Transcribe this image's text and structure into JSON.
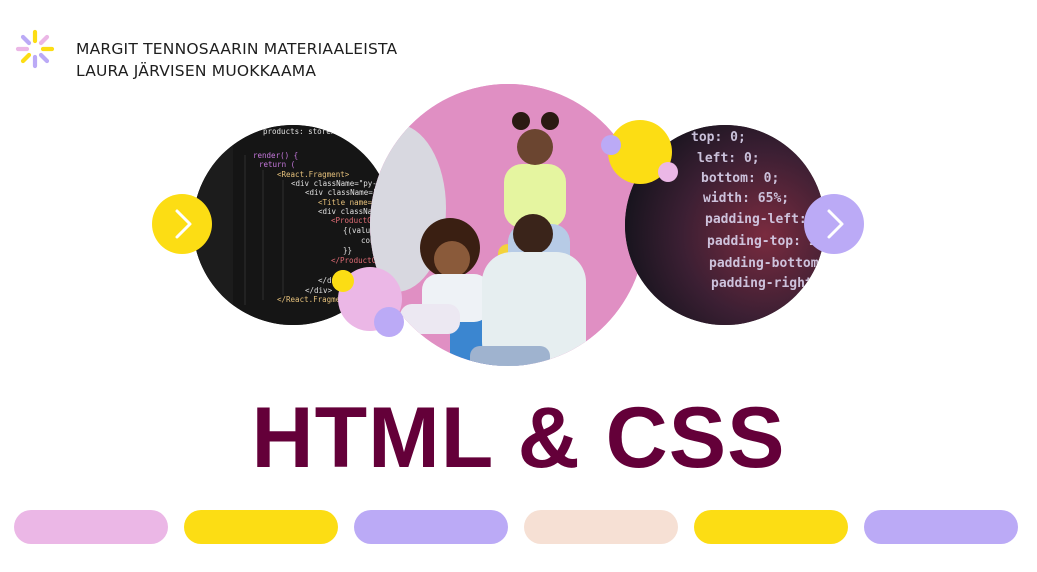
{
  "header": {
    "logo_icon": "asterisk-star-logo",
    "line1": "MARGIT TENNOSAARIN MATERIAALEISTA",
    "line2": "LAURA JÄRVISEN MUOKKAAMA"
  },
  "carousel": {
    "prev_icon": "chevron-right-icon",
    "next_icon": "chevron-right-icon",
    "left_code_lines": [
      "products: storeProd",
      "render() {",
      "return (",
      "<React.Fragment>",
      "<div className=\"py-5\">",
      "<div className=\"contain",
      "<Title name=\"our\" ti",
      "<div className=\"row\"",
      "<ProductConsumer",
      "{(value) =>",
      "console",
      "}}",
      "</ProductConsu",
      "</div>",
      "</div>",
      "</React.Fragment>"
    ],
    "right_code_lines": [
      "top: 0;",
      "left: 0;",
      "bottom: 0;",
      "width: 65%;",
      "padding-left: 1",
      "padding-top: 100",
      "padding-bottom:",
      "padding-right:"
    ]
  },
  "title": "HTML & CSS",
  "colors": {
    "title": "#640039",
    "pink": "#ebb7e6",
    "yellow": "#fcdd14",
    "lavender": "#bbaaf6",
    "peach": "#f6e0d4",
    "photo_bg": "#e190c4"
  },
  "pills": [
    "pink",
    "yellow",
    "lavender",
    "peach",
    "yellow",
    "lavender"
  ]
}
